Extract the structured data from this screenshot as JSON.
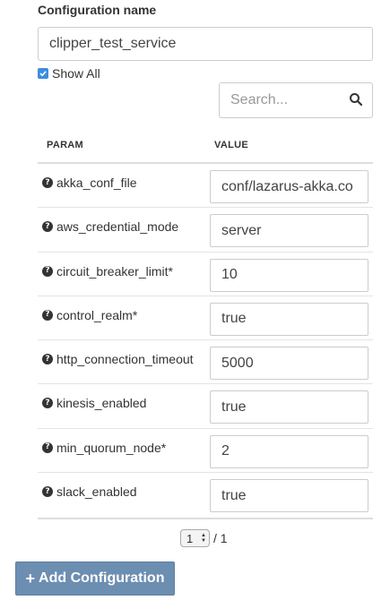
{
  "config": {
    "label": "Configuration name",
    "value": "clipper_test_service"
  },
  "show_all": {
    "label": "Show All",
    "checked": true
  },
  "search": {
    "placeholder": "Search..."
  },
  "table": {
    "headers": {
      "param": "PARAM",
      "value": "VALUE"
    },
    "rows": [
      {
        "param": "akka_conf_file",
        "value": "conf/lazarus-akka.co"
      },
      {
        "param": "aws_credential_mode",
        "value": "server"
      },
      {
        "param": "circuit_breaker_limit*",
        "value": "10"
      },
      {
        "param": "control_realm*",
        "value": "true"
      },
      {
        "param": "http_connection_timeout",
        "value": "5000"
      },
      {
        "param": "kinesis_enabled",
        "value": "true"
      },
      {
        "param": "min_quorum_node*",
        "value": "2"
      },
      {
        "param": "slack_enabled",
        "value": "true"
      }
    ]
  },
  "pagination": {
    "current": "1",
    "separator": "/ 1"
  },
  "add_button": {
    "label": "Add Configuration",
    "icon": "plus-icon"
  },
  "colors": {
    "accent": "#3b8ede",
    "button": "#6c8eb1"
  }
}
